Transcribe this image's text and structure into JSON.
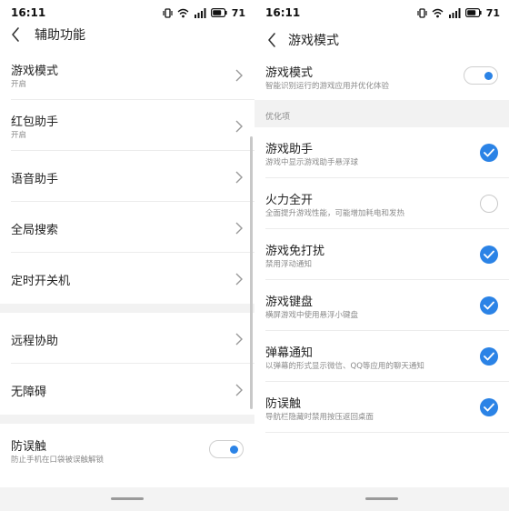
{
  "left": {
    "status": {
      "time": "16:11",
      "battery": "71"
    },
    "title": "辅助功能",
    "groups": [
      [
        {
          "title": "游戏模式",
          "sub": "开启"
        },
        {
          "title": "红包助手",
          "sub": "开启"
        },
        {
          "title": "语音助手",
          "sub": ""
        },
        {
          "title": "全局搜索",
          "sub": ""
        },
        {
          "title": "定时开关机",
          "sub": ""
        }
      ],
      [
        {
          "title": "远程协助",
          "sub": ""
        },
        {
          "title": "无障碍",
          "sub": ""
        }
      ]
    ],
    "toggle_item": {
      "title": "防误触",
      "sub": "防止手机在口袋被误触解锁",
      "on": true
    }
  },
  "right": {
    "status": {
      "time": "16:11",
      "battery": "71"
    },
    "title": "游戏模式",
    "main_toggle": {
      "title": "游戏模式",
      "sub": "智能识别运行的游戏应用并优化体验",
      "on": true
    },
    "section_label": "优化项",
    "items": [
      {
        "title": "游戏助手",
        "sub": "游戏中显示游戏助手悬浮球",
        "checked": true
      },
      {
        "title": "火力全开",
        "sub": "全面提升游戏性能，可能增加耗电和发热",
        "checked": false
      },
      {
        "title": "游戏免打扰",
        "sub": "禁用浮动通知",
        "checked": true
      },
      {
        "title": "游戏键盘",
        "sub": "横屏游戏中使用悬浮小键盘",
        "checked": true
      },
      {
        "title": "弹幕通知",
        "sub": "以弹幕的形式显示微信、QQ等应用的聊天通知",
        "checked": true
      },
      {
        "title": "防误触",
        "sub": "导航栏隐藏时禁用按压返回桌面",
        "checked": true
      }
    ]
  },
  "colors": {
    "accent": "#2b83e6",
    "divider": "#ececec",
    "gap": "#f2f2f2"
  }
}
